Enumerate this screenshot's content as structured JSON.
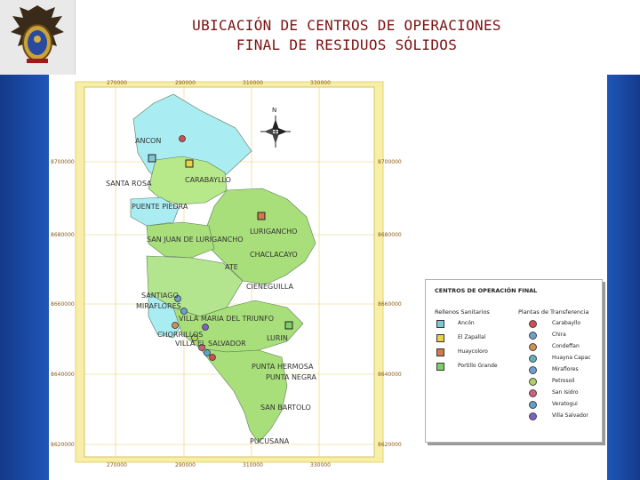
{
  "title": {
    "line1": "UBICACIÓN DE CENTROS DE OPERACIONES",
    "line2": "FINAL DE RESIDUOS SÓLIDOS"
  },
  "map": {
    "north_label": "N",
    "x_coords": [
      "270000",
      "290000",
      "310000",
      "330000"
    ],
    "y_coords": [
      "8700000",
      "8680000",
      "8660000",
      "8640000",
      "8620000"
    ],
    "districts": [
      "ANCON",
      "SANTA ROSA",
      "CARABAYLLO",
      "PUENTE PIEDRA",
      "SAN JUAN DE LURIGANCHO",
      "LURIGANCHO",
      "CHACLACAYO",
      "ATE",
      "CIENEGUILLA",
      "SANTIAGO",
      "MIRAFLORES",
      "VILLA MARIA DEL TRIUNFO",
      "CHORRILLOS",
      "VILLA EL SALVADOR",
      "LURIN",
      "PUNTA HERMOSA",
      "PUNTA NEGRA",
      "SAN BARTOLO",
      "PUCUSANA"
    ]
  },
  "legend": {
    "title": "CENTROS DE OPERACIÓN FINAL",
    "col1_header": "Rellenos Sanitarios",
    "col2_header": "Plantas de Transferencia",
    "rellenos": [
      "Ancón",
      "El Zapallal",
      "Huaycoloro",
      "Portillo Grande"
    ],
    "plantas": [
      "Carabayllo",
      "Chira",
      "Condeffan",
      "Huayna Capac",
      "Miraflores",
      "Petrosoil",
      "San Isidro",
      "Veratogui",
      "Villa Salvador"
    ]
  },
  "colors": {
    "header_text": "#7a1212",
    "side_bar": "#1f56b8",
    "map_green": "#a8df7a",
    "map_cyan": "#a9ecf2",
    "map_frame": "#f3e79a"
  }
}
